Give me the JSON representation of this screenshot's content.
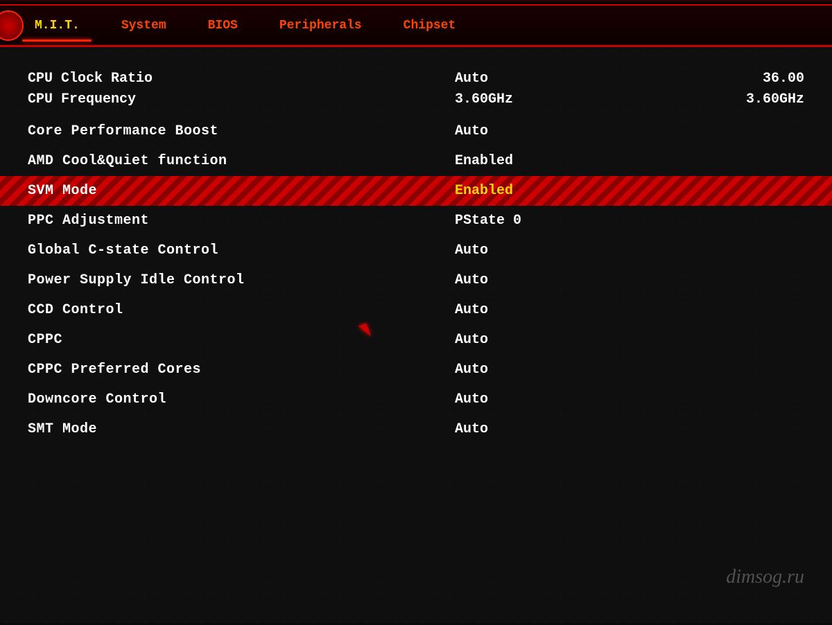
{
  "nav": {
    "tabs": [
      {
        "id": "mit",
        "label": "M.I.T.",
        "active": true
      },
      {
        "id": "system",
        "label": "System",
        "active": false
      },
      {
        "id": "bios",
        "label": "BIOS",
        "active": false
      },
      {
        "id": "peripherals",
        "label": "Peripherals",
        "active": false
      },
      {
        "id": "chipset",
        "label": "Chipset",
        "active": false
      }
    ]
  },
  "settings": {
    "cpu_clock_ratio": {
      "name": "CPU Clock Ratio",
      "value1": "Auto",
      "value2": "36.00"
    },
    "cpu_frequency": {
      "name": "CPU Frequency",
      "value1": "3.60GHz",
      "value2": "3.60GHz"
    },
    "core_performance_boost": {
      "name": "Core Performance Boost",
      "value": "Auto"
    },
    "amd_cool_quiet": {
      "name": "AMD Cool&Quiet function",
      "value": "Enabled"
    },
    "svm_mode": {
      "name": "SVM Mode",
      "value": "Enabled",
      "highlighted": true
    },
    "ppc_adjustment": {
      "name": "PPC Adjustment",
      "value": "PState 0"
    },
    "global_cstate": {
      "name": "Global C-state Control",
      "value": "Auto"
    },
    "power_supply_idle": {
      "name": "Power Supply Idle Control",
      "value": "Auto"
    },
    "ccd_control": {
      "name": "CCD Control",
      "value": "Auto"
    },
    "cppc": {
      "name": "CPPC",
      "value": "Auto"
    },
    "cppc_preferred": {
      "name": "CPPC Preferred Cores",
      "value": "Auto"
    },
    "downcore_control": {
      "name": "Downcore Control",
      "value": "Auto"
    },
    "smt_mode": {
      "name": "SMT Mode",
      "value": "Auto"
    }
  },
  "watermark": "dimsog.ru"
}
